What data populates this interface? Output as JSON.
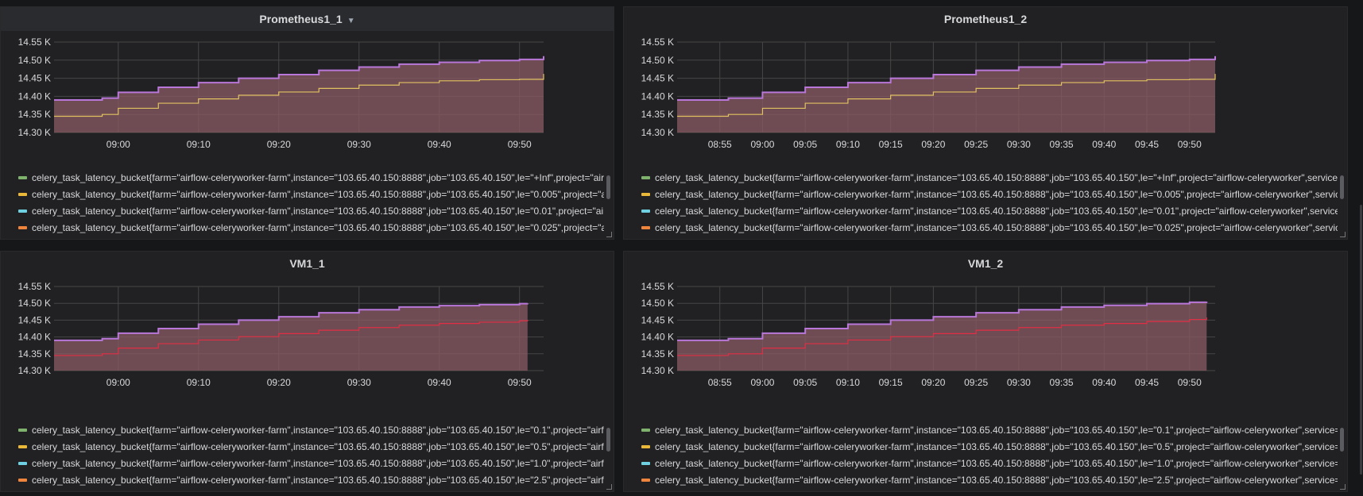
{
  "colors": {
    "panel_bg": "#212124",
    "grid": "#464646",
    "axis_text": "#d8d9da",
    "line_top": "#b877d9",
    "line_mid_prom": "#e0c261",
    "line_mid_vm": "#e02f44",
    "area_fill": "#8a5a63"
  },
  "panels": [
    {
      "title": "Prometheus1_1",
      "has_menu_caret": true,
      "legend": [
        {
          "label": "celery_task_latency_bucket{farm=\"airflow-celeryworker-farm\",instance=\"103.65.40.150:8888\",job=\"103.65.40.150\",le=\"+Inf\",project=\"airf",
          "color": "#7eb26d"
        },
        {
          "label": "celery_task_latency_bucket{farm=\"airflow-celeryworker-farm\",instance=\"103.65.40.150:8888\",job=\"103.65.40.150\",le=\"0.005\",project=\"ai",
          "color": "#eab839"
        },
        {
          "label": "celery_task_latency_bucket{farm=\"airflow-celeryworker-farm\",instance=\"103.65.40.150:8888\",job=\"103.65.40.150\",le=\"0.01\",project=\"airfl",
          "color": "#6ed0e0"
        },
        {
          "label": "celery_task_latency_bucket{farm=\"airflow-celeryworker-farm\",instance=\"103.65.40.150:8888\",job=\"103.65.40.150\",le=\"0.025\",project=\"ai",
          "color": "#ef843c"
        }
      ]
    },
    {
      "title": "Prometheus1_2",
      "has_menu_caret": false,
      "legend": [
        {
          "label": "celery_task_latency_bucket{farm=\"airflow-celeryworker-farm\",instance=\"103.65.40.150:8888\",job=\"103.65.40.150\",le=\"+Inf\",project=\"airflow-celeryworker\",service=\"",
          "color": "#7eb26d"
        },
        {
          "label": "celery_task_latency_bucket{farm=\"airflow-celeryworker-farm\",instance=\"103.65.40.150:8888\",job=\"103.65.40.150\",le=\"0.005\",project=\"airflow-celeryworker\",service=",
          "color": "#eab839"
        },
        {
          "label": "celery_task_latency_bucket{farm=\"airflow-celeryworker-farm\",instance=\"103.65.40.150:8888\",job=\"103.65.40.150\",le=\"0.01\",project=\"airflow-celeryworker\",service=\"",
          "color": "#6ed0e0"
        },
        {
          "label": "celery_task_latency_bucket{farm=\"airflow-celeryworker-farm\",instance=\"103.65.40.150:8888\",job=\"103.65.40.150\",le=\"0.025\",project=\"airflow-celeryworker\",service=",
          "color": "#ef843c"
        }
      ]
    },
    {
      "title": "VM1_1",
      "has_menu_caret": false,
      "legend": [
        {
          "label": "celery_task_latency_bucket{farm=\"airflow-celeryworker-farm\",instance=\"103.65.40.150:8888\",job=\"103.65.40.150\",le=\"0.1\",project=\"airflo",
          "color": "#7eb26d"
        },
        {
          "label": "celery_task_latency_bucket{farm=\"airflow-celeryworker-farm\",instance=\"103.65.40.150:8888\",job=\"103.65.40.150\",le=\"0.5\",project=\"airflo",
          "color": "#eab839"
        },
        {
          "label": "celery_task_latency_bucket{farm=\"airflow-celeryworker-farm\",instance=\"103.65.40.150:8888\",job=\"103.65.40.150\",le=\"1.0\",project=\"airflo",
          "color": "#6ed0e0"
        },
        {
          "label": "celery_task_latency_bucket{farm=\"airflow-celeryworker-farm\",instance=\"103.65.40.150:8888\",job=\"103.65.40.150\",le=\"2.5\",project=\"airflo",
          "color": "#ef843c"
        }
      ]
    },
    {
      "title": "VM1_2",
      "has_menu_caret": false,
      "legend": [
        {
          "label": "celery_task_latency_bucket{farm=\"airflow-celeryworker-farm\",instance=\"103.65.40.150:8888\",job=\"103.65.40.150\",le=\"0.1\",project=\"airflow-celeryworker\",service=\"",
          "color": "#7eb26d"
        },
        {
          "label": "celery_task_latency_bucket{farm=\"airflow-celeryworker-farm\",instance=\"103.65.40.150:8888\",job=\"103.65.40.150\",le=\"0.5\",project=\"airflow-celeryworker\",service=\"",
          "color": "#eab839"
        },
        {
          "label": "celery_task_latency_bucket{farm=\"airflow-celeryworker-farm\",instance=\"103.65.40.150:8888\",job=\"103.65.40.150\",le=\"1.0\",project=\"airflow-celeryworker\",service=\"",
          "color": "#6ed0e0"
        },
        {
          "label": "celery_task_latency_bucket{farm=\"airflow-celeryworker-farm\",instance=\"103.65.40.150:8888\",job=\"103.65.40.150\",le=\"2.5\",project=\"airflow-celeryworker\",service=\"",
          "color": "#ef843c"
        }
      ]
    }
  ],
  "chart_data": [
    {
      "type": "area",
      "title": "Prometheus1_1",
      "x": [
        "08:52",
        "08:58",
        "09:00",
        "09:05",
        "09:10",
        "09:15",
        "09:20",
        "09:25",
        "09:30",
        "09:35",
        "09:40",
        "09:45",
        "09:50",
        "09:53"
      ],
      "xticks": [
        "09:00",
        "09:10",
        "09:20",
        "09:30",
        "09:40",
        "09:50"
      ],
      "xlim": [
        "08:52",
        "09:53"
      ],
      "ylim": [
        14300,
        14550
      ],
      "yticks": [
        "14.30 K",
        "14.35 K",
        "14.40 K",
        "14.45 K",
        "14.50 K",
        "14.55 K"
      ],
      "series": [
        {
          "values": [
            14390,
            14395,
            14411,
            14425,
            14438,
            14450,
            14460,
            14472,
            14481,
            14489,
            14494,
            14499,
            14502,
            14511
          ],
          "color": "#b877d9"
        },
        {
          "values": [
            14345,
            14350,
            14367,
            14381,
            14393,
            14403,
            14412,
            14422,
            14431,
            14438,
            14443,
            14446,
            14447,
            14462
          ],
          "color": "#e0c261"
        }
      ],
      "grid": true
    },
    {
      "type": "area",
      "title": "Prometheus1_2",
      "x": [
        "08:50",
        "08:56",
        "09:00",
        "09:05",
        "09:10",
        "09:15",
        "09:20",
        "09:25",
        "09:30",
        "09:35",
        "09:40",
        "09:45",
        "09:50",
        "09:53"
      ],
      "xticks": [
        "08:55",
        "09:00",
        "09:05",
        "09:10",
        "09:15",
        "09:20",
        "09:25",
        "09:30",
        "09:35",
        "09:40",
        "09:45",
        "09:50"
      ],
      "xlim": [
        "08:50",
        "09:53"
      ],
      "ylim": [
        14300,
        14550
      ],
      "yticks": [
        "14.30 K",
        "14.35 K",
        "14.40 K",
        "14.45 K",
        "14.50 K",
        "14.55 K"
      ],
      "series": [
        {
          "values": [
            14390,
            14395,
            14411,
            14425,
            14438,
            14450,
            14460,
            14472,
            14481,
            14489,
            14494,
            14499,
            14502,
            14511
          ],
          "color": "#b877d9"
        },
        {
          "values": [
            14345,
            14350,
            14367,
            14381,
            14393,
            14403,
            14412,
            14422,
            14431,
            14438,
            14443,
            14446,
            14447,
            14462
          ],
          "color": "#e0c261"
        }
      ],
      "grid": true
    },
    {
      "type": "area",
      "title": "VM1_1",
      "x": [
        "08:52",
        "08:58",
        "09:00",
        "09:05",
        "09:10",
        "09:15",
        "09:20",
        "09:25",
        "09:30",
        "09:35",
        "09:40",
        "09:45",
        "09:50",
        "09:51"
      ],
      "xticks": [
        "09:00",
        "09:10",
        "09:20",
        "09:30",
        "09:40",
        "09:50"
      ],
      "xlim": [
        "08:52",
        "09:53"
      ],
      "ylim": [
        14300,
        14550
      ],
      "yticks": [
        "14.30 K",
        "14.35 K",
        "14.40 K",
        "14.45 K",
        "14.50 K",
        "14.55 K"
      ],
      "series": [
        {
          "values": [
            14390,
            14395,
            14411,
            14425,
            14438,
            14450,
            14460,
            14472,
            14481,
            14489,
            14493,
            14496,
            14499,
            14500
          ],
          "color": "#b877d9"
        },
        {
          "values": [
            14345,
            14350,
            14367,
            14380,
            14391,
            14401,
            14410,
            14420,
            14428,
            14435,
            14440,
            14444,
            14448,
            14451
          ],
          "color": "#e02f44"
        }
      ],
      "grid": true
    },
    {
      "type": "area",
      "title": "VM1_2",
      "x": [
        "08:50",
        "08:56",
        "09:00",
        "09:05",
        "09:10",
        "09:15",
        "09:20",
        "09:25",
        "09:30",
        "09:35",
        "09:40",
        "09:45",
        "09:50",
        "09:52"
      ],
      "xticks": [
        "08:55",
        "09:00",
        "09:05",
        "09:10",
        "09:15",
        "09:20",
        "09:25",
        "09:30",
        "09:35",
        "09:40",
        "09:45",
        "09:50"
      ],
      "xlim": [
        "08:50",
        "09:53"
      ],
      "ylim": [
        14300,
        14550
      ],
      "yticks": [
        "14.30 K",
        "14.35 K",
        "14.40 K",
        "14.45 K",
        "14.50 K",
        "14.55 K"
      ],
      "series": [
        {
          "values": [
            14390,
            14395,
            14411,
            14425,
            14438,
            14450,
            14460,
            14472,
            14481,
            14489,
            14494,
            14499,
            14503,
            14505
          ],
          "color": "#b877d9"
        },
        {
          "values": [
            14345,
            14350,
            14367,
            14380,
            14391,
            14401,
            14410,
            14420,
            14428,
            14435,
            14440,
            14446,
            14452,
            14458
          ],
          "color": "#e02f44"
        }
      ],
      "grid": true
    }
  ]
}
